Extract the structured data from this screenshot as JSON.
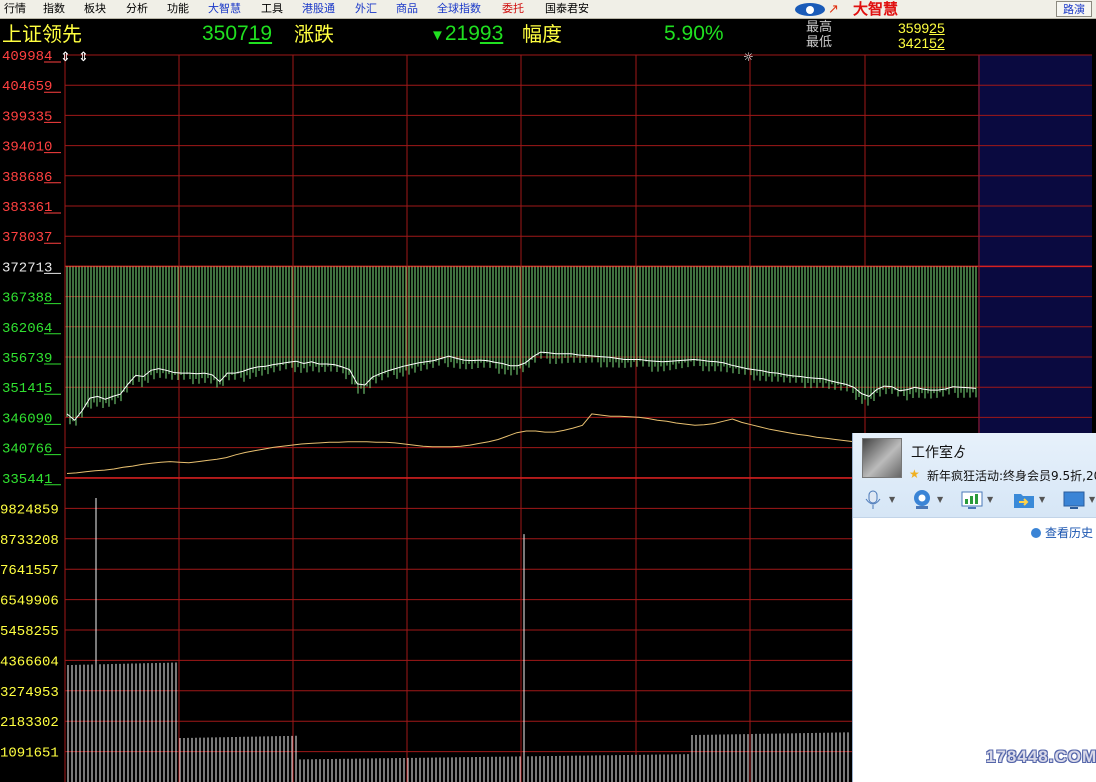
{
  "menu": [
    {
      "label": "行情",
      "color": "#000000"
    },
    {
      "label": "指数",
      "color": "#000000"
    },
    {
      "label": "板块",
      "color": "#000000"
    },
    {
      "label": "分析",
      "color": "#000000"
    },
    {
      "label": "功能",
      "color": "#000000"
    },
    {
      "label": "大智慧",
      "color": "#1a38c8"
    },
    {
      "label": "工具",
      "color": "#000000"
    },
    {
      "label": "港股通",
      "color": "#1a38c8"
    },
    {
      "label": "外汇",
      "color": "#1a38c8"
    },
    {
      "label": "商品",
      "color": "#1a38c8"
    },
    {
      "label": "全球指数",
      "color": "#1a38c8"
    },
    {
      "label": "委托",
      "color": "#d01010"
    },
    {
      "label": "国泰君安",
      "color": "#000000"
    }
  ],
  "logo_text": "大智慧",
  "road_button": "路演",
  "quote": {
    "title": "上证领先",
    "price_main": "3507",
    "price_tail": "19",
    "change_label": "涨跌",
    "change_arrow": "▼",
    "change_main": "219",
    "change_tail": "93",
    "amplitude_label": "幅度",
    "amplitude": "5.90%",
    "high_label": "最高",
    "low_label": "最低",
    "high_main": "3599",
    "high_tail": "25",
    "low_main": "3421",
    "low_tail": "52"
  },
  "chart_data": {
    "type": "line",
    "reference_price": "372713",
    "price_axis": {
      "ticks_above": [
        "409984",
        "404659",
        "399335",
        "394010",
        "388686",
        "383361",
        "378037"
      ],
      "reference": "372713",
      "ticks_below": [
        "367388",
        "362064",
        "356739",
        "351415",
        "346090",
        "340766",
        "335441"
      ]
    },
    "volume_axis": {
      "ticks": [
        "9824859",
        "8733208",
        "7641557",
        "6549906",
        "5458255",
        "4366604",
        "3274953",
        "2183302",
        "1091651"
      ]
    },
    "series": [
      {
        "role": "price",
        "color": "#ffffff",
        "values": [
          346700,
          345600,
          347300,
          349500,
          349800,
          349300,
          349800,
          350200,
          352000,
          353500,
          353300,
          354400,
          354700,
          354400,
          354000,
          353900,
          353900,
          353800,
          353900,
          353600,
          352400,
          353900,
          353900,
          354200,
          354700,
          355000,
          355100,
          355400,
          355600,
          355800,
          356000,
          355600,
          355900,
          355500,
          355500,
          355400,
          355000,
          354500,
          352000,
          351800,
          353200,
          353800,
          354300,
          354700,
          355100,
          355400,
          355700,
          355900,
          356100,
          356500,
          356900,
          356500,
          356200,
          356100,
          356200,
          356100,
          355800,
          355600,
          355200,
          355200,
          355700,
          356800,
          357600,
          357500,
          357300,
          357300,
          357300,
          357100,
          357000,
          356900,
          356800,
          356700,
          356500,
          356300,
          356300,
          356300,
          356100,
          356000,
          355900,
          356000,
          356100,
          356200,
          356300,
          356200,
          356000,
          355900,
          355700,
          355300,
          355000,
          354700,
          354500,
          354300,
          354000,
          353900,
          353600,
          353400,
          353300,
          353100,
          353000,
          352900,
          352500,
          352200,
          351900,
          351400,
          350300,
          349800,
          351000,
          351600,
          351500,
          350800,
          351000,
          351400,
          351100,
          350900,
          350900,
          351100,
          351500,
          351400,
          351300,
          351200
        ]
      },
      {
        "role": "average",
        "color": "#e8c070",
        "values": [
          336200,
          336300,
          336500,
          336700,
          336800,
          337000,
          337300,
          337500,
          337800,
          338000,
          338200,
          338300,
          338200,
          338100,
          338300,
          338500,
          338700,
          339000,
          339500,
          339900,
          340200,
          340500,
          340800,
          341000,
          341200,
          341400,
          341500,
          341600,
          341700,
          341700,
          341800,
          341800,
          341800,
          341700,
          341700,
          341600,
          341400,
          341200,
          341000,
          340900,
          340900,
          340900,
          341000,
          341200,
          341500,
          341800,
          342200,
          342800,
          343400,
          343700,
          343700,
          343500,
          343500,
          343800,
          344200,
          344700,
          346700,
          346500,
          346300,
          346300,
          346200,
          346100,
          345900,
          345600,
          345400,
          345100,
          344900,
          344700,
          344800,
          345000,
          345400,
          345800,
          345200,
          344800,
          344400,
          344000,
          343700,
          343400,
          343100,
          342900,
          342600,
          342400,
          342200,
          342000,
          341800,
          341700,
          341500,
          341300,
          341100,
          341000,
          340800,
          340500,
          340300,
          340100,
          339900,
          339600,
          339500,
          339900
        ]
      }
    ]
  },
  "chat": {
    "name": "工作室ゟ",
    "status": "新年疯狂活动:终身会员9.5折,20",
    "history_label": "查看历史"
  },
  "watermark": "178448.COM"
}
